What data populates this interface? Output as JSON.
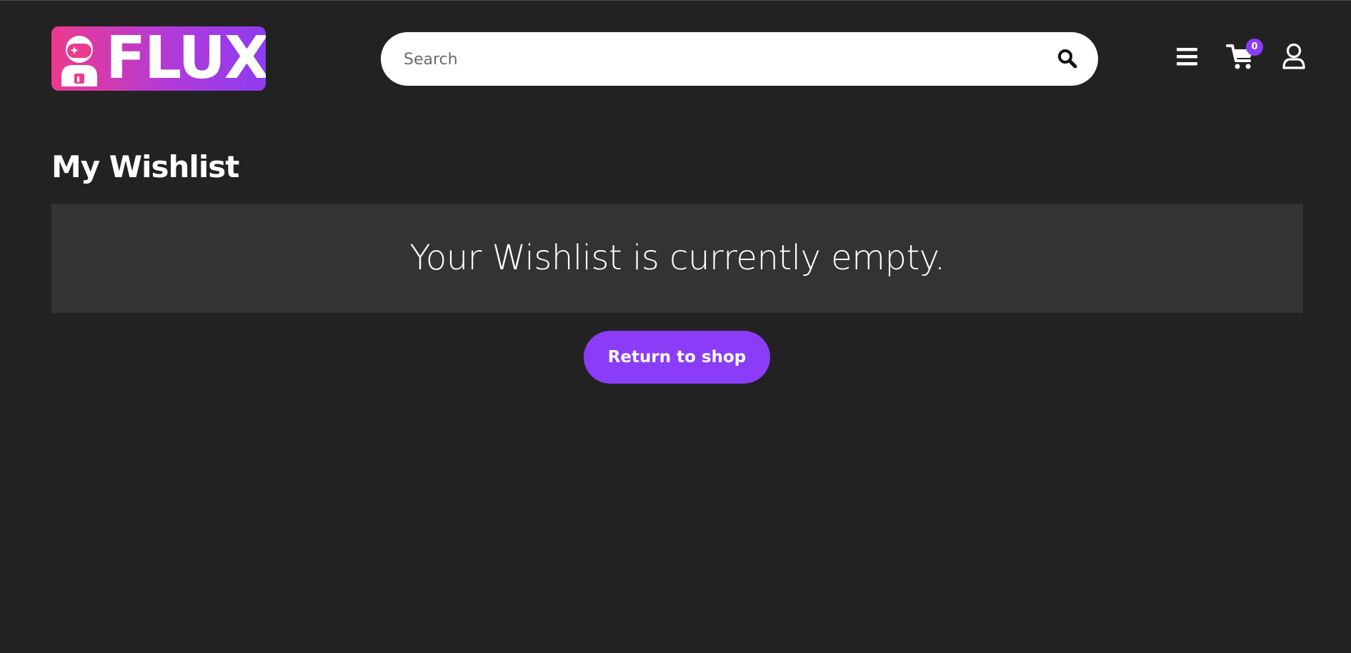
{
  "brand": {
    "logo_text": "FLUX",
    "gradient_start": "#ec3a8e",
    "gradient_end": "#8d3cf0",
    "mascot_icon": "astronaut-icon"
  },
  "header": {
    "search": {
      "placeholder": "Search",
      "value": "",
      "icon": "search-icon"
    },
    "menu_icon": "hamburger-menu-icon",
    "cart": {
      "icon": "shopping-cart-icon",
      "count": "0"
    },
    "account_icon": "user-icon"
  },
  "main": {
    "title": "My Wishlist",
    "empty_message": "Your Wishlist is currently empty.",
    "return_button_label": "Return to shop"
  },
  "colors": {
    "background": "#222222",
    "panel": "#333333",
    "accent": "#8b3cf6",
    "text": "#ffffff"
  }
}
